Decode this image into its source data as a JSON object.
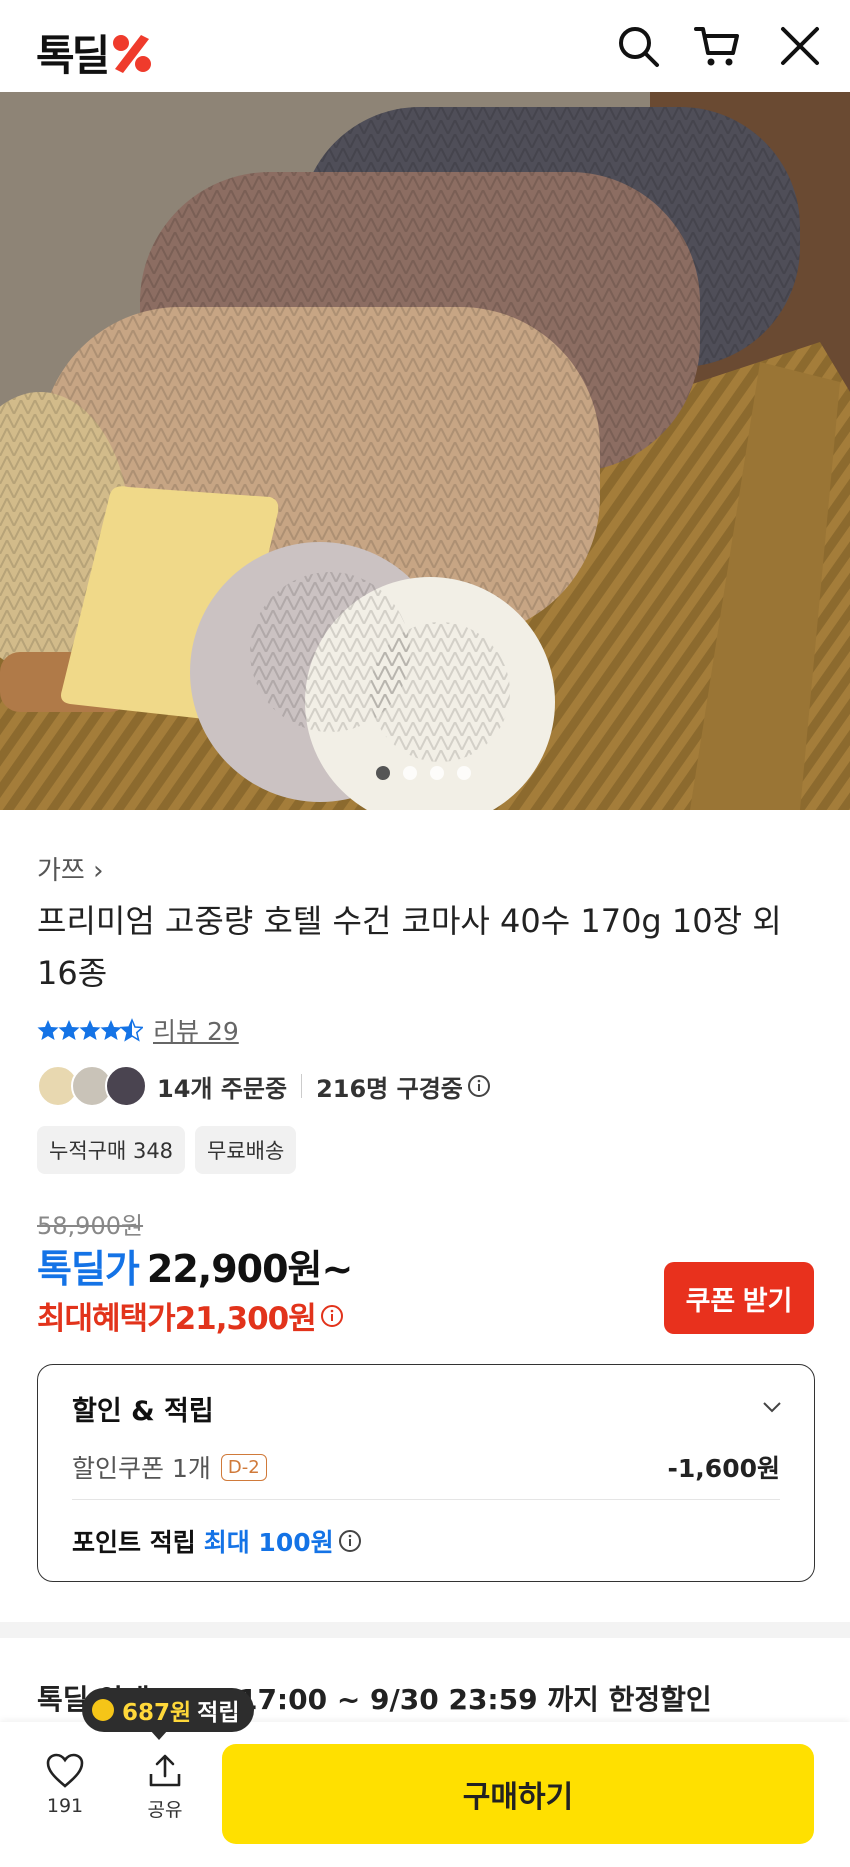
{
  "header": {
    "logo": "톡딜",
    "logo_icon": "percent-logo-icon",
    "search_icon": "search-icon",
    "cart_icon": "cart-icon",
    "close_icon": "close-icon"
  },
  "gallery": {
    "total": 4,
    "current": 1
  },
  "product": {
    "brand": "가쯔",
    "brand_chevron": "›",
    "title": "프리미엄 고중량 호텔 수건 코마사 40수 170g 10장 외 16종",
    "rating": 4.5,
    "review_label": "리뷰 29",
    "ordering": "14개 주문중",
    "watching": "216명 구경중",
    "tags": [
      "누적구매 348",
      "무료배송"
    ],
    "original_price": "58,900원",
    "deal_label": "톡딜가",
    "deal_price": "22,900원~",
    "max_label": "최대혜택가",
    "max_price": "21,300원",
    "coupon_button": "쿠폰 받기"
  },
  "benefits": {
    "title": "할인 & 적립",
    "coupon_label": "할인쿠폰 1개",
    "coupon_dday": "D-2",
    "coupon_amount": "-1,600원",
    "point_label": "포인트 적립",
    "point_max": "최대 100원"
  },
  "notice": "톡딜 안내  9/27 17:00 ~ 9/30 23:59 까지 한정할인",
  "bottom": {
    "point_amount": "687원",
    "point_suffix": "적립",
    "like_count": "191",
    "share_label": "공유",
    "buy_button": "구매하기"
  },
  "colors": {
    "deal_blue": "#1473e6",
    "sale_red": "#e2331b",
    "buy_yellow": "#ffe000"
  }
}
